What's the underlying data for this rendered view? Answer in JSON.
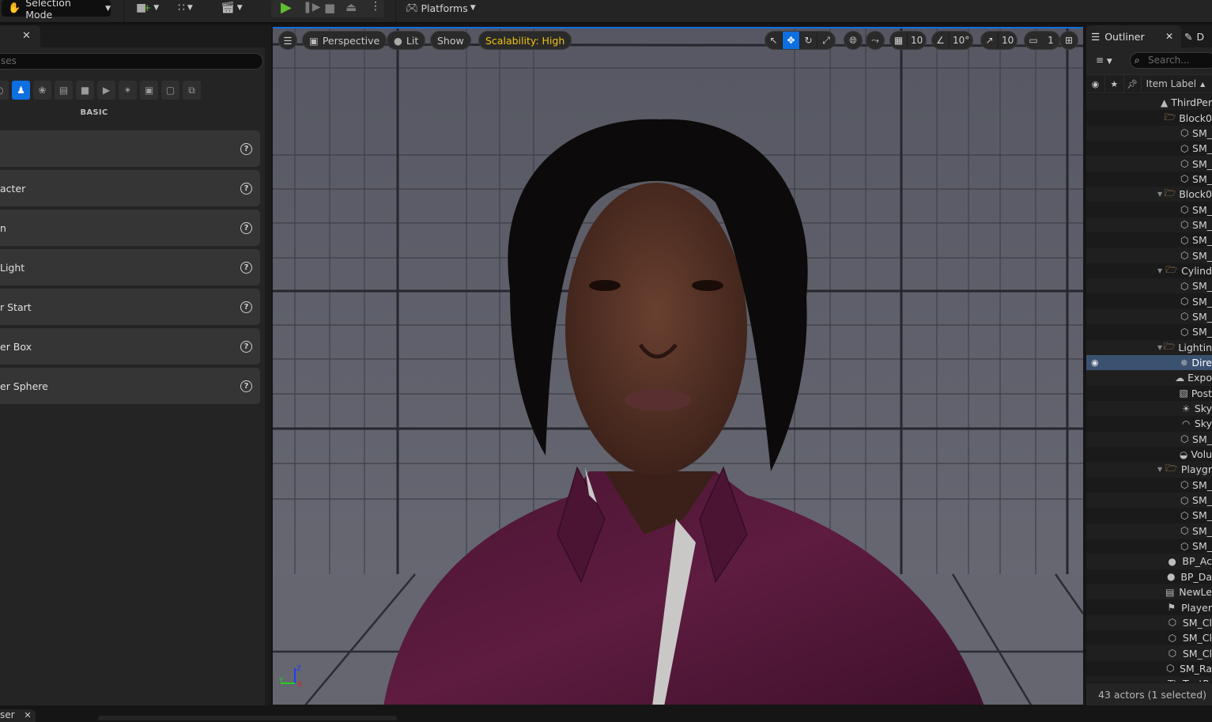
{
  "toolbar": {
    "mode_label": "Selection Mode",
    "platforms_label": "Platforms",
    "icons": [
      "selection-mode-icon",
      "add-actor-icon",
      "blueprint-icon",
      "cinematics-icon",
      "play-icon",
      "advance-frame-icon",
      "stop-icon",
      "eject-icon",
      "more-options-icon",
      "platforms-icon"
    ]
  },
  "place_actors": {
    "search_placeholder": "Search Classes",
    "search_visible_text": "ses",
    "category_label": "BASIC",
    "categories": [
      "recently-placed",
      "basic",
      "lights",
      "cinematic",
      "visual-effects",
      "geometry",
      "volumes",
      "all-classes",
      "shapes",
      "other"
    ],
    "active_category": "basic",
    "items": [
      {
        "label": ""
      },
      {
        "label": "acter"
      },
      {
        "label": "n"
      },
      {
        "label": "Light"
      },
      {
        "label": "r Start"
      },
      {
        "label": "er Box"
      },
      {
        "label": "er Sphere"
      }
    ]
  },
  "viewport": {
    "menu_icon": "hamburger-icon",
    "perspective_label": "Perspective",
    "lit_label": "Lit",
    "show_label": "Show",
    "scalability_label": "Scalability: High",
    "grid_snap": "10",
    "rotation_snap": "10°",
    "scale_snap": "10",
    "camera_speed": "1",
    "active_transform": "translate",
    "axis_labels": {
      "x": "X",
      "y": "Y",
      "z": "Z"
    },
    "colors": {
      "accent": "#0e6fe0",
      "scalability": "#f1c40f",
      "shirt": "#5b1a3d"
    }
  },
  "outliner": {
    "tab_label": "Outliner",
    "second_tab_label": "D",
    "search_placeholder": "Search...",
    "column_label": "Item Label",
    "rows": [
      {
        "label": "ThirdPer",
        "icon": "level-icon",
        "indent": 0,
        "arrow": false
      },
      {
        "label": "Block0",
        "icon": "folder-icon",
        "indent": 1,
        "arrow": false
      },
      {
        "label": "SM_",
        "icon": "static-mesh-icon",
        "indent": 2
      },
      {
        "label": "SM_",
        "icon": "static-mesh-icon",
        "indent": 2
      },
      {
        "label": "SM_",
        "icon": "static-mesh-icon",
        "indent": 2
      },
      {
        "label": "SM_",
        "icon": "static-mesh-icon",
        "indent": 2
      },
      {
        "label": "Block0",
        "icon": "folder-icon",
        "indent": 1,
        "arrow": true
      },
      {
        "label": "SM_",
        "icon": "static-mesh-icon",
        "indent": 2
      },
      {
        "label": "SM_",
        "icon": "static-mesh-icon",
        "indent": 2
      },
      {
        "label": "SM_",
        "icon": "static-mesh-icon",
        "indent": 2
      },
      {
        "label": "SM_",
        "icon": "static-mesh-icon",
        "indent": 2
      },
      {
        "label": "Cylind",
        "icon": "folder-icon",
        "indent": 1,
        "arrow": true
      },
      {
        "label": "SM_",
        "icon": "static-mesh-icon",
        "indent": 2
      },
      {
        "label": "SM_",
        "icon": "static-mesh-icon",
        "indent": 2
      },
      {
        "label": "SM_",
        "icon": "static-mesh-icon",
        "indent": 2
      },
      {
        "label": "SM_",
        "icon": "static-mesh-icon",
        "indent": 2
      },
      {
        "label": "Lightin",
        "icon": "folder-icon",
        "indent": 1,
        "arrow": true
      },
      {
        "label": "Dire",
        "icon": "directional-light-icon",
        "indent": 2,
        "selected": true
      },
      {
        "label": "Expo",
        "icon": "exponential-fog-icon",
        "indent": 2
      },
      {
        "label": "Post",
        "icon": "post-process-icon",
        "indent": 2
      },
      {
        "label": "Sky",
        "icon": "sky-atmosphere-icon",
        "indent": 2
      },
      {
        "label": "Sky",
        "icon": "sky-light-icon",
        "indent": 2
      },
      {
        "label": "SM_",
        "icon": "static-mesh-icon",
        "indent": 2
      },
      {
        "label": "Volu",
        "icon": "volumetric-cloud-icon",
        "indent": 2
      },
      {
        "label": "Playgr",
        "icon": "folder-icon",
        "indent": 1,
        "arrow": true
      },
      {
        "label": "SM_",
        "icon": "static-mesh-icon",
        "indent": 2
      },
      {
        "label": "SM_",
        "icon": "static-mesh-icon",
        "indent": 2
      },
      {
        "label": "SM_",
        "icon": "static-mesh-icon",
        "indent": 2
      },
      {
        "label": "SM_",
        "icon": "static-mesh-icon",
        "indent": 2
      },
      {
        "label": "SM_",
        "icon": "static-mesh-icon",
        "indent": 2
      },
      {
        "label": "BP_Ac",
        "icon": "blueprint-actor-icon",
        "indent": 1
      },
      {
        "label": "BP_Da",
        "icon": "blueprint-actor-icon",
        "indent": 1
      },
      {
        "label": "NewLe",
        "icon": "level-sequence-icon",
        "indent": 1
      },
      {
        "label": "Player",
        "icon": "player-start-icon",
        "indent": 1
      },
      {
        "label": "SM_Cl",
        "icon": "static-mesh-icon",
        "indent": 1
      },
      {
        "label": "SM_Cl",
        "icon": "static-mesh-icon",
        "indent": 1
      },
      {
        "label": "SM_Cl",
        "icon": "static-mesh-icon",
        "indent": 1
      },
      {
        "label": "SM_Ra",
        "icon": "static-mesh-icon",
        "indent": 1
      },
      {
        "label": "TextR",
        "icon": "text-render-icon",
        "indent": 1
      }
    ],
    "status": "43 actors (1 selected)"
  },
  "bottom": {
    "tab_label": "ser"
  }
}
